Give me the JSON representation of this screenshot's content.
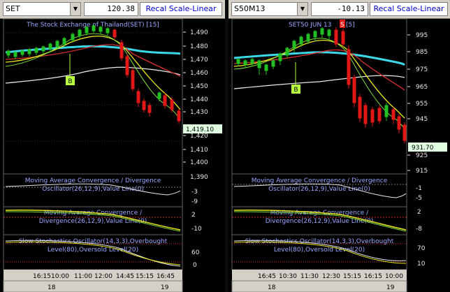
{
  "left": {
    "symbol": "SET",
    "change": "120.38",
    "recal_label": "Recal Scale-Linear",
    "title": "The Stock Exchange of Thailand(SET) [15]",
    "last_price": "1,419.10",
    "buy_signal": "B",
    "price_ticks": [
      "1,490",
      "1,480",
      "1,470",
      "1,460",
      "1,450",
      "1,440",
      "1,430",
      "1,420",
      "1,410",
      "1,400",
      "1,390"
    ],
    "macd1_title": "Moving Average Convergence / Divergence",
    "macd1_sub": "Oscillator(26,12,9),Value Line(0)",
    "macd1_ticks": [
      "-3",
      "-9"
    ],
    "macd2_title": "Moving Average Convergence /",
    "macd2_sub": "Divergence(26,12,9),Value Line(0)",
    "macd2_ticks": [
      "2",
      "-10"
    ],
    "stoch_title": "Slow Stochastics Oscillator(14,3,3),Overbought",
    "stoch_sub": "Level(80),Oversold Level(20)",
    "stoch_ticks": [
      "60",
      "0"
    ],
    "time_labels": [
      "16:15",
      "10:00",
      "11:00",
      "12:00",
      "14:45",
      "15:15",
      "16:45"
    ],
    "date_labels": [
      "18",
      "19"
    ]
  },
  "right": {
    "symbol": "S50M13",
    "change": "-10.13",
    "recal_label": "Recal Scale-Linear",
    "title_a": "SET50 JUN 13",
    "title_badge": "S",
    "title_b": "[5]",
    "last_price": "931.70",
    "buy_signal": "B",
    "price_ticks": [
      "995",
      "985",
      "975",
      "965",
      "955",
      "945",
      "935",
      "925",
      "915"
    ],
    "macd1_title": "Moving Average Convergence / Divergence",
    "macd1_sub": "Oscillator(26,12,9),Value Line(0)",
    "macd1_ticks": [
      "-1",
      "-5"
    ],
    "macd2_title": "Moving Average Convergence /",
    "macd2_sub": "Divergence(26,12,9),Value Line(0)",
    "macd2_ticks": [
      "2",
      "-8"
    ],
    "stoch_title": "Slow Stochastics Oscillator(14,3,3),Overbought",
    "stoch_sub": "Level(80),Oversold Level(20)",
    "stoch_ticks": [
      "70",
      "10"
    ],
    "time_labels": [
      "16:45",
      "10:30",
      "11:30",
      "12:30",
      "15:15",
      "16:15",
      "10:00"
    ],
    "date_labels": [
      "18",
      "19"
    ]
  },
  "colors": {
    "up_candle": "#22c022",
    "down_candle": "#e01818",
    "ma_cyan": "#3cd8e8",
    "ma_yellow": "#e8e820",
    "ma_red": "#d83030",
    "ma_white": "#e8e8e8",
    "ma_green": "#80e040",
    "title_blue": "#9aa8ff",
    "signal_box": "#b8ff40",
    "last_box": "#e0ffe0",
    "stoch_dots": "#d03030"
  }
}
